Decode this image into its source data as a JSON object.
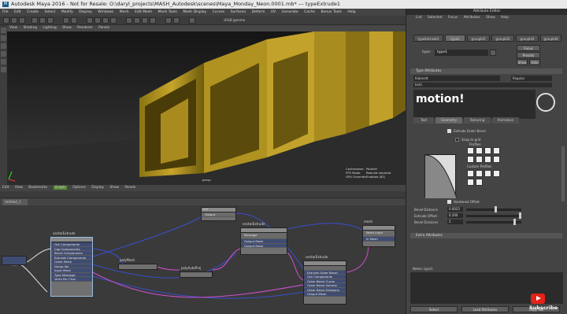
{
  "window": {
    "title": "Autodesk Maya 2016 - Not for Resale: O:\\daryl_projects\\MASH_Autodesk\\scenes\\Maya_Monday_Neon.0001.mb* --- typeExtrude1"
  },
  "menubar": {
    "items": [
      "File",
      "Edit",
      "Create",
      "Select",
      "Modify",
      "Display",
      "Windows",
      "Mesh",
      "Edit Mesh",
      "Mesh Tools",
      "Mesh Display",
      "Curves",
      "Surfaces",
      "Deform",
      "UV",
      "Generate",
      "Cache",
      "Bonus Tools",
      "Help"
    ]
  },
  "viewport": {
    "menu": [
      "View",
      "Shading",
      "Lighting",
      "Show",
      "Renderer",
      "Panels"
    ],
    "camera": "persp",
    "colorspace": "sRGB gamma",
    "hud_labels": [
      "Cachename",
      "FPS Mode",
      "GPU Override"
    ],
    "hud_values": [
      "Parallel",
      "Rebuild required",
      "Enabled (81)"
    ],
    "scene_text": "motion!"
  },
  "node_editor": {
    "menu": [
      "Edit",
      "View",
      "Bookmarks",
      "Graph",
      "Options",
      "Display",
      "Show",
      "Panels"
    ],
    "tab": "Untitled_1",
    "nodes": {
      "vectorExtrude1": {
        "title": "vectorExtrude",
        "rows": [
          "Out Components",
          "Cap Components",
          "Bevel Components",
          "Extrude Components",
          "Outer Mesh",
          "Group Ids",
          "Input Mesh",
          "Type Message",
          "Verts Per Char"
        ]
      },
      "polyMesh": {
        "title": "polyMesh"
      },
      "polyAutoProj": {
        "title": "polyAutoProj"
      },
      "vectorExtrude2": {
        "title": "vectorExtrude",
        "rows": [
          "Message",
          "Output Mesh",
          "Output Mesh"
        ]
      },
      "vectorExtrude3": {
        "title": "vectorExtrude",
        "rows": [
          "Extrude Outer Bevel",
          "Out Components",
          "Outer Bevel Curve",
          "Outer Bevel Volume",
          "Outer Bevel Divisions",
          "Output Mesh"
        ]
      },
      "top": {
        "title": "out",
        "rows": [
          "Output"
        ]
      },
      "mesh": {
        "title": "mesh",
        "rows": [
          "Mesh Input",
          "In Mesh"
        ]
      }
    }
  },
  "attribute_editor": {
    "title": "Attribute Editor",
    "menu": [
      "List",
      "Selected",
      "Focus",
      "Attributes",
      "Show",
      "Help"
    ],
    "tabs": [
      "typeExtrude1",
      "type1",
      "groupId1",
      "groupId2",
      "groupId3",
      "groupId4"
    ],
    "type_label": "type:",
    "type_value": "type1",
    "buttons": [
      "Focus",
      "Presets",
      "Show",
      "Hide"
    ],
    "section_title": "Type Attributes",
    "font_name": "Kabinett",
    "font_style": "Regular",
    "style_row": "bold",
    "text": "motion!",
    "page_tabs": [
      "Text",
      "Geometry",
      "Texturing",
      "Animation"
    ],
    "extrude_outer_bevel": "Extrude Outer Bevel",
    "snap_to_grid": "Snap to grid",
    "profiles_label": "Profiles",
    "custom_profiles_label": "Custom Profiles",
    "hardened_offset": "Hardened Offset",
    "bevel_distance_label": "Bevel Distance",
    "bevel_distance_value": "0.0025",
    "extrude_offset_label": "Extrude Offset",
    "extrude_offset_value": "0.200",
    "bevel_divisions_label": "Bevel Divisions",
    "bevel_divisions_value": "2",
    "extra_section": "Extra Attributes",
    "notes_label": "Notes: type1",
    "bottom_buttons": [
      "Select",
      "Load Attributes",
      "Copy Tab"
    ]
  },
  "watermark": {
    "subscribe": "Subscribe"
  },
  "colors": {
    "accent_orange": "#e07a20",
    "node_blue": "#3f4c72",
    "youtube_red": "#e62117"
  }
}
